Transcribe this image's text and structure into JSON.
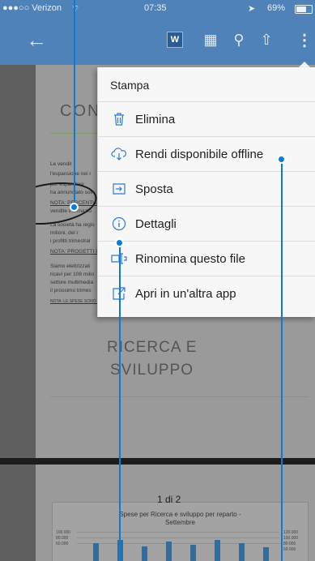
{
  "status_bar": {
    "carrier": "●●●○○ Verizon",
    "time": "07:35",
    "battery": "69%"
  },
  "toolbar": {
    "back_icon": "arrow-left-icon",
    "word_label": "W",
    "icons": [
      "word-doc-icon",
      "grid-icon",
      "search-icon",
      "share-icon",
      "more-vertical-icon"
    ]
  },
  "menu": {
    "items": [
      {
        "label": "Stampa",
        "icon": ""
      },
      {
        "label": "Elimina",
        "icon": "trash-icon"
      },
      {
        "label": "Rendi disponibile offline",
        "icon": "cloud-download-icon"
      },
      {
        "label": "Sposta",
        "icon": "move-icon"
      },
      {
        "label": "Dettagli",
        "icon": "info-icon"
      },
      {
        "label": "Rinomina questo file",
        "icon": "rename-icon"
      },
      {
        "label": "Apri in un'altra app",
        "icon": "open-external-icon"
      }
    ]
  },
  "document": {
    "heading": "CON",
    "paragraphs": [
      "Le vendit",
      "l'espansione nei r",
      "per espandere",
      "ha annunciato soli",
      "NOTA: PERCENTUALE",
      "vendite internazio",
      "La società ha regis",
      "milioni, del r",
      "i profitti trimestral",
      "NOTA: PROGETTI PER",
      "Siamo elettrizzati",
      "ricavi per 108 milio",
      "settore multimedia",
      "il prossimo trimes"
    ],
    "note": "NOTA: LE SPESE SONO RIMASTE STABILI QUEST'ANNO, NONOSTANTE I RIBASSI E I GUASTI IMPREVISTI DELLE APPARECCHIATURE",
    "section_title_line1": "RICERCA E",
    "section_title_line2": "SVILUPPO"
  },
  "chart_page": {
    "title_line1": "Spese per Ricerca e sviluppo per reparto -",
    "title_line2": "Settembre",
    "left_ticks": [
      "100.000",
      "80.000",
      "60.000"
    ],
    "right_ticks": [
      "120.000",
      "100.000",
      "80.000",
      "60.000"
    ]
  },
  "page_indicator": "1 di 2"
}
